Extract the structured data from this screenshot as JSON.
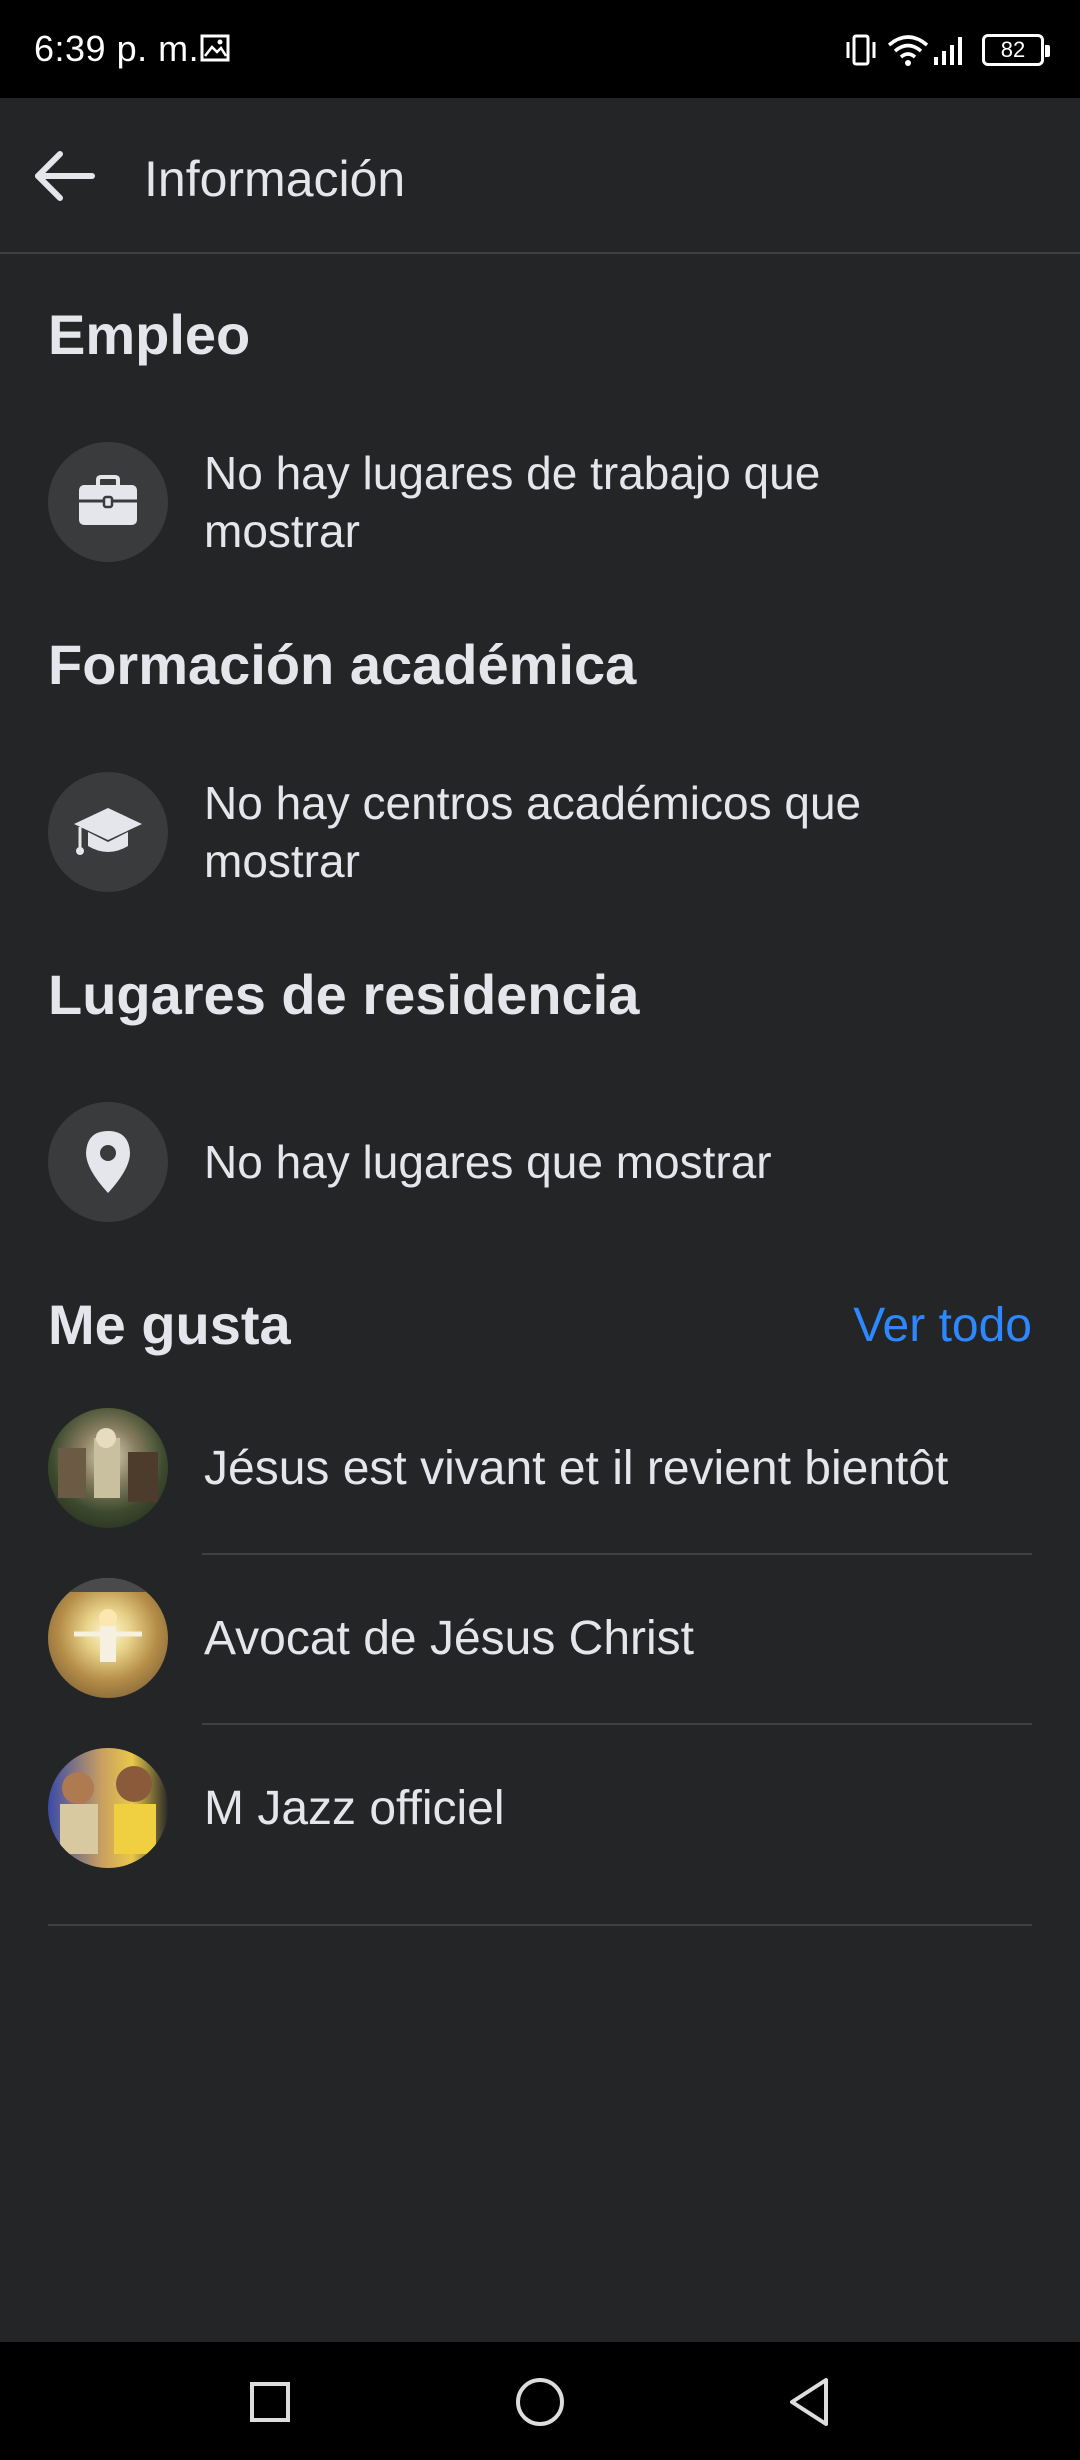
{
  "status_bar": {
    "time": "6:39 p. m.",
    "battery": "82",
    "icons": [
      "image-icon",
      "vibrate-icon",
      "wifi-icon",
      "signal-icon",
      "battery-icon"
    ]
  },
  "header": {
    "title": "Información",
    "back_icon": "arrow-left-icon"
  },
  "sections": {
    "employment": {
      "title": "Empleo",
      "text": "No hay lugares de trabajo que mostrar",
      "icon": "briefcase-icon"
    },
    "education": {
      "title": "Formación académica",
      "text": "No hay centros académicos que mostrar",
      "icon": "graduation-cap-icon"
    },
    "places": {
      "title": "Lugares de residencia",
      "text": "No hay lugares que mostrar",
      "icon": "location-pin-icon"
    },
    "likes": {
      "title": "Me gusta",
      "see_all": "Ver todo",
      "items": [
        {
          "name": "Jésus est vivant et il revient bientôt"
        },
        {
          "name": "Avocat de Jésus Christ"
        },
        {
          "name": "M Jazz officiel"
        }
      ]
    }
  },
  "nav_bar": {
    "icons": [
      "recents-square-icon",
      "home-circle-icon",
      "back-triangle-icon"
    ]
  },
  "colors": {
    "background": "#242526",
    "text": "#e4e6eb",
    "accent": "#2d88ff",
    "icon_bg": "#3a3b3c",
    "divider": "#3e4042"
  }
}
